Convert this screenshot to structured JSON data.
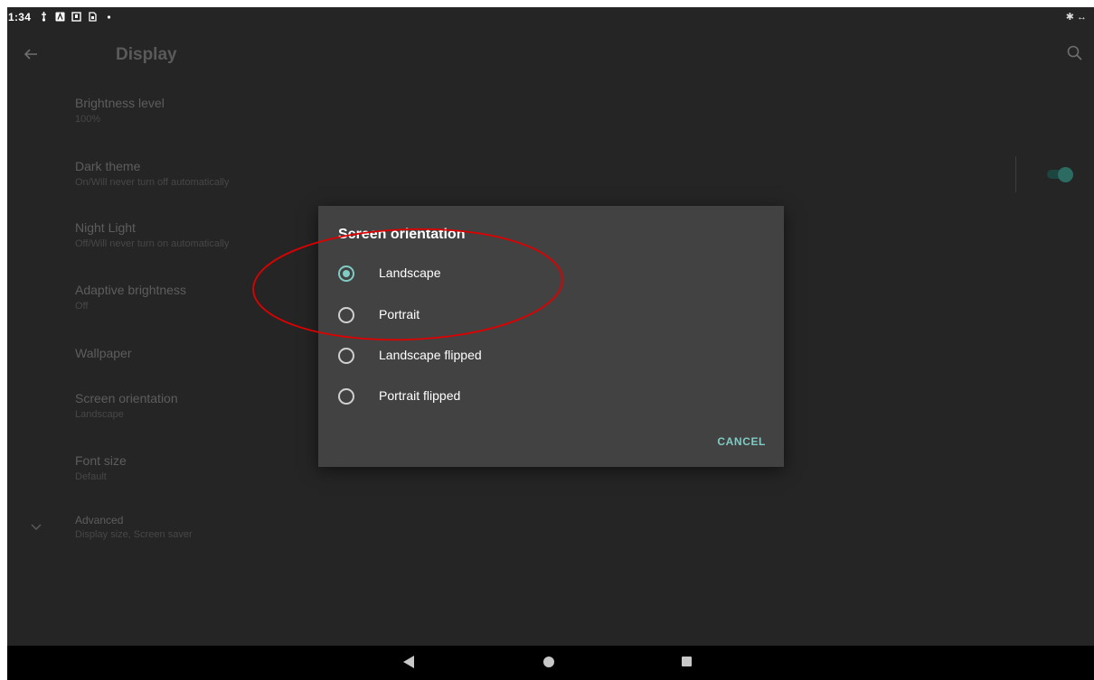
{
  "status_bar": {
    "time": "1:34",
    "icons": [
      "usb-icon",
      "notification-a-icon",
      "notification-box-icon",
      "notification-sim-icon",
      "dot-icon"
    ],
    "right_icons": [
      "bluetooth-icon",
      "data-sync-icon"
    ]
  },
  "app_bar": {
    "title": "Display",
    "back_icon": "arrow-back-icon",
    "search_icon": "search-icon"
  },
  "preferences": [
    {
      "title": "Brightness level",
      "summary": "100%"
    },
    {
      "title": "Dark theme",
      "summary": "On/Will never turn off automatically",
      "toggle": true
    },
    {
      "title": "Night Light",
      "summary": "Off/Will never turn on automatically"
    },
    {
      "title": "Adaptive brightness",
      "summary": "Off"
    },
    {
      "title": "Wallpaper",
      "summary": ""
    },
    {
      "title": "Screen orientation",
      "summary": "Landscape"
    },
    {
      "title": "Font size",
      "summary": "Default"
    },
    {
      "title": "Advanced",
      "summary": "Display size, Screen saver"
    }
  ],
  "dialog": {
    "title": "Screen orientation",
    "options": [
      {
        "label": "Landscape",
        "checked": true
      },
      {
        "label": "Portrait",
        "checked": false
      },
      {
        "label": "Landscape flipped",
        "checked": false
      },
      {
        "label": "Portrait flipped",
        "checked": false
      }
    ],
    "cancel_label": "CANCEL"
  },
  "colors": {
    "accent": "#80cbc4",
    "annotation": "#e00000",
    "background": "#252525",
    "dialog_background": "#424242"
  }
}
